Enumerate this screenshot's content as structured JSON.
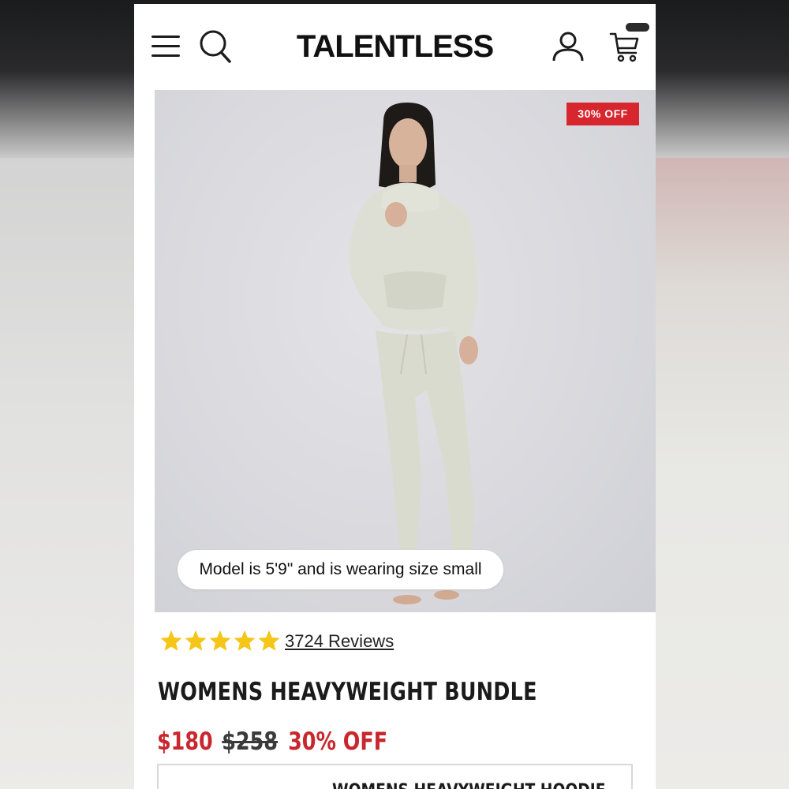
{
  "header": {
    "brand": "TALENTLESS",
    "menu_icon": "hamburger-menu-icon",
    "search_icon": "search-icon",
    "account_icon": "user-account-icon",
    "cart_icon": "shopping-cart-icon"
  },
  "hero": {
    "discount_badge": "30% OFF",
    "model_note": "Model is 5'9\" and is wearing size small"
  },
  "product": {
    "rating_stars": 5,
    "reviews_label": "3724 Reviews",
    "title": "WOMENS HEAVYWEIGHT BUNDLE",
    "price_sale": "$180",
    "price_original": "$258",
    "price_discount": "30% OFF",
    "option_label": "WOMENS HEAVYWEIGHT HOODIE"
  },
  "colors": {
    "accent_red": "#d7262d",
    "star_yellow": "#f5c518",
    "text_dark": "#1b1b1b"
  }
}
